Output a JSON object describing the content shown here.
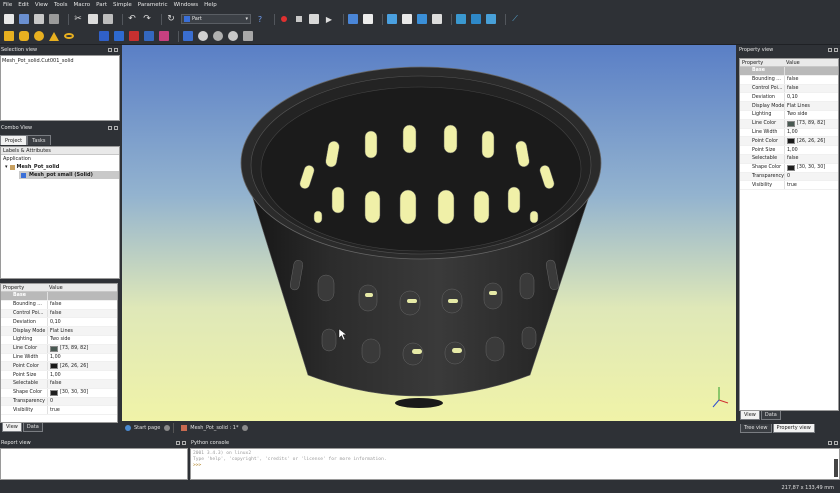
{
  "menu": [
    "File",
    "Edit",
    "View",
    "Tools",
    "Macro",
    "Part",
    "Simple",
    "Parametric",
    "Windows",
    "Help"
  ],
  "workbench": {
    "selected": "Part"
  },
  "selection_view": {
    "title": "Selection view",
    "content": "Mesh_Pot_solid.Cut001_solid"
  },
  "combo_view": {
    "title": "Combo View",
    "tabs": [
      "Project",
      "Tasks"
    ],
    "tree_header": "Labels & Attributes",
    "tree_root": "Application",
    "doc": "Mesh_Pot_solid",
    "item": "Mesh_pot small (Solid)"
  },
  "props_left": {
    "col_property": "Property",
    "col_value": "Value",
    "group": "Base",
    "rows": [
      {
        "k": "Bounding ...",
        "v": "false"
      },
      {
        "k": "Control Poi...",
        "v": "false"
      },
      {
        "k": "Deviation",
        "v": "0,10"
      },
      {
        "k": "Display Mode",
        "v": "Flat Lines"
      },
      {
        "k": "Lighting",
        "v": "Two side"
      },
      {
        "k": "Line Color",
        "v": "[73, 89, 82]",
        "color": "#495952"
      },
      {
        "k": "Line Width",
        "v": "1,00"
      },
      {
        "k": "Point Color",
        "v": "[26, 26, 26]",
        "color": "#1a1a1a"
      },
      {
        "k": "Point Size",
        "v": "1,00"
      },
      {
        "k": "Selectable",
        "v": "false"
      },
      {
        "k": "Shape Color",
        "v": "[30, 30, 30]",
        "color": "#1e1e1e"
      },
      {
        "k": "Transparency",
        "v": "0"
      },
      {
        "k": "Visibility",
        "v": "true"
      }
    ],
    "tabs": [
      "View",
      "Data"
    ]
  },
  "property_view": {
    "title": "Property view",
    "col_property": "Property",
    "col_value": "Value",
    "group": "Base",
    "rows": [
      {
        "k": "Bounding ...",
        "v": "false"
      },
      {
        "k": "Control Poi...",
        "v": "false"
      },
      {
        "k": "Deviation",
        "v": "0,10"
      },
      {
        "k": "Display Mode",
        "v": "Flat Lines"
      },
      {
        "k": "Lighting",
        "v": "Two side"
      },
      {
        "k": "Line Color",
        "v": "[73, 89, 82]",
        "color": "#495952"
      },
      {
        "k": "Line Width",
        "v": "1,00"
      },
      {
        "k": "Point Color",
        "v": "[26, 26, 26]",
        "color": "#1a1a1a"
      },
      {
        "k": "Point Size",
        "v": "1,00"
      },
      {
        "k": "Selectable",
        "v": "false"
      },
      {
        "k": "Shape Color",
        "v": "[30, 30, 30]",
        "color": "#1e1e1e"
      },
      {
        "k": "Transparency",
        "v": "0"
      },
      {
        "k": "Visibility",
        "v": "true"
      }
    ],
    "tabs": [
      "View",
      "Data"
    ],
    "bottom_tabs": [
      "Tree view",
      "Property view"
    ]
  },
  "doc_tabs": [
    {
      "label": "Start page"
    },
    {
      "label": "Mesh_Pot_solid : 1*"
    }
  ],
  "report_view": {
    "title": "Report view"
  },
  "python_console": {
    "title": "Python console",
    "lines": [
      "2001 3.4.3) on linux2",
      "Type 'help', 'copyright', 'credits' or 'license' for more information.",
      ">>> "
    ]
  },
  "status": {
    "dimensions": "217,87 x 133,49 mm"
  },
  "colors": {
    "bg_top": "#5a7fc6",
    "bg_bottom": "#f0f3a8",
    "pot": "#2a2a2a",
    "chrome": "#2e3136"
  }
}
